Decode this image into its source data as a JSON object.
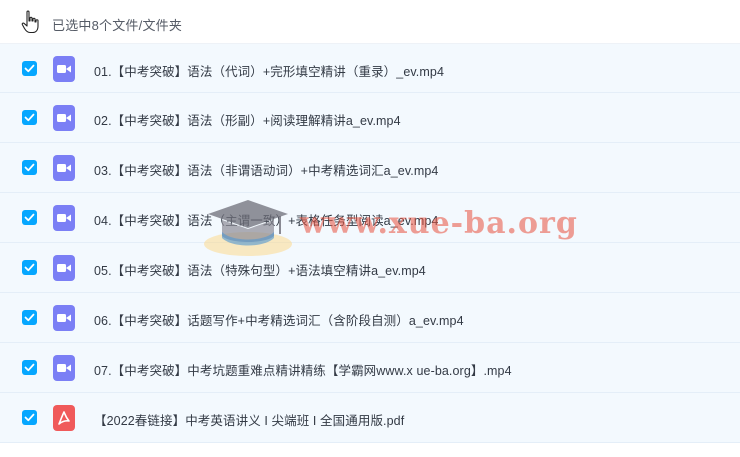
{
  "header": {
    "selection_text": "已选中8个文件/文件夹"
  },
  "files": [
    {
      "name": "01.【中考突破】语法（代词）+完形填空精讲（重录）_ev.mp4",
      "type": "video",
      "checked": true
    },
    {
      "name": "02.【中考突破】语法（形副）+阅读理解精讲a_ev.mp4",
      "type": "video",
      "checked": true
    },
    {
      "name": "03.【中考突破】语法（非谓语动词）+中考精选词汇a_ev.mp4",
      "type": "video",
      "checked": true
    },
    {
      "name": "04.【中考突破】语法（主谓一致）+表格任务型阅读a_ev.mp4",
      "type": "video",
      "checked": true
    },
    {
      "name": "05.【中考突破】语法（特殊句型）+语法填空精讲a_ev.mp4",
      "type": "video",
      "checked": true
    },
    {
      "name": "06.【中考突破】话题写作+中考精选词汇（含阶段自测）a_ev.mp4",
      "type": "video",
      "checked": true
    },
    {
      "name": "07.【中考突破】中考坑题重难点精讲精练【学霸网www.x ue-ba.org】.mp4",
      "type": "video",
      "checked": true
    },
    {
      "name": "【2022春链接】中考英语讲义 I 尖端班 I 全国通用版.pdf",
      "type": "pdf",
      "checked": true
    }
  ],
  "watermark": {
    "text": "www.xue-ba.org"
  },
  "colors": {
    "checkbox": "#06a7ff",
    "video_icon": "#7b7ff5",
    "pdf_icon": "#f05a5a",
    "row_bg": "#f3f9fe"
  }
}
